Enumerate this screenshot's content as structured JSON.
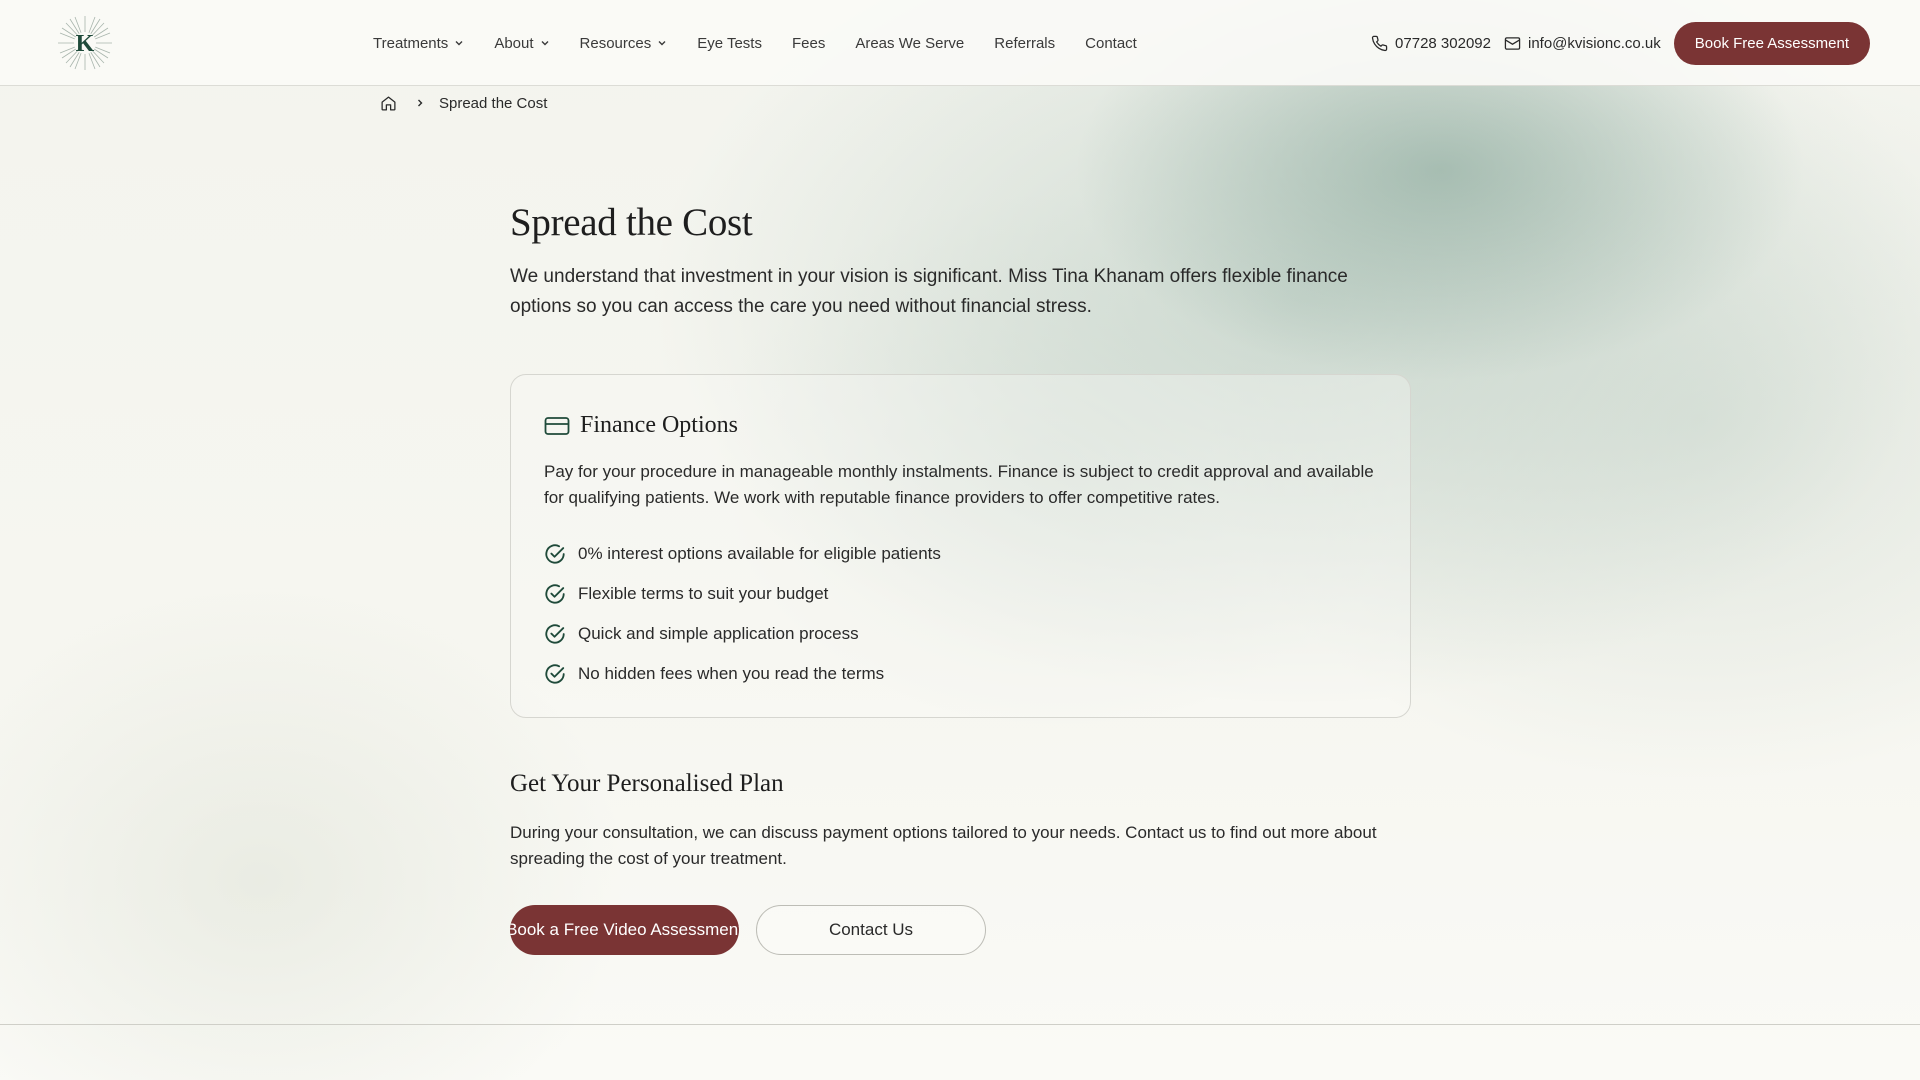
{
  "brand": {
    "logo_letter": "K",
    "accent": "#7a3434",
    "icon_green": "#1f4a3a"
  },
  "nav": {
    "items": [
      {
        "label": "Treatments",
        "dropdown": true
      },
      {
        "label": "About",
        "dropdown": true
      },
      {
        "label": "Resources",
        "dropdown": true
      },
      {
        "label": "Eye Tests",
        "dropdown": false
      },
      {
        "label": "Fees",
        "dropdown": false
      },
      {
        "label": "Areas We Serve",
        "dropdown": false
      },
      {
        "label": "Referrals",
        "dropdown": false
      },
      {
        "label": "Contact",
        "dropdown": false
      }
    ]
  },
  "contact": {
    "phone": "07728 302092",
    "email": "info@kvisionc.co.uk",
    "book_label": "Book Free Assessment"
  },
  "breadcrumb": {
    "home_icon": "home-icon",
    "current": "Spread the Cost"
  },
  "page": {
    "title": "Spread the Cost",
    "intro": "We understand that investment in your vision is significant. Miss Tina Khanam offers flexible finance options so you can access the care you need without financial stress."
  },
  "finance": {
    "icon": "credit-card-icon",
    "title": "Finance Options",
    "text": "Pay for your procedure in manageable monthly instalments. Finance is subject to credit approval and available for qualifying patients. We work with reputable finance providers to offer competitive rates.",
    "features": [
      "0% interest options available for eligible patients",
      "Flexible terms to suit your budget",
      "Quick and simple application process",
      "No hidden fees when you read the terms"
    ]
  },
  "plan": {
    "title": "Get Your Personalised Plan",
    "text": "During your consultation, we can discuss payment options tailored to your needs. Contact us to find out more about spreading the cost of your treatment.",
    "video_button": "Book a Free Video Assessment",
    "contact_button": "Contact Us"
  }
}
